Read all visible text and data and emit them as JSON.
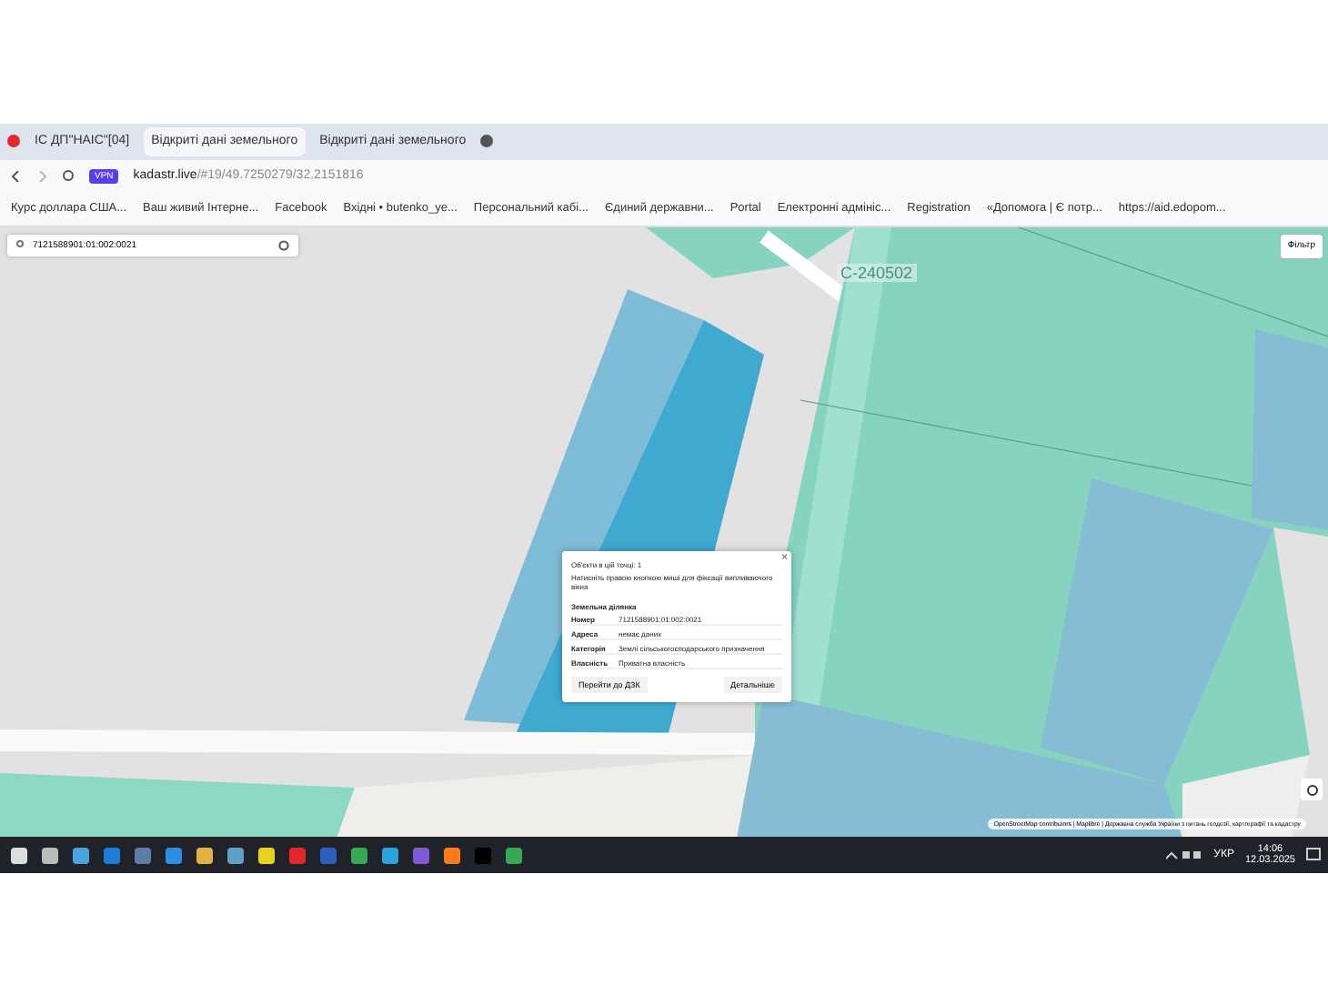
{
  "browser": {
    "tabs": [
      {
        "title": "ІС ДП\"НАІС\"[04]",
        "selected": false
      },
      {
        "title": "Відкриті дані земельного",
        "selected": true
      },
      {
        "title": "Відкриті дані земельного",
        "selected": false
      }
    ],
    "vpn": "VPN",
    "address": {
      "host": "kadastr.live",
      "path": "/#19/49.7250279/32.2151816"
    },
    "bookmarks": [
      "Курс доллара США...",
      "Ваш живий Інтерне...",
      "Facebook",
      "Вхідні • butenko_ye...",
      "Персональний кабі...",
      "Єдиний державни...",
      "Portal",
      "Електронні адмініс...",
      "Registration",
      "«Допомога | Є потр...",
      "https://aid.edopom..."
    ]
  },
  "map": {
    "search": {
      "value": "7121588901:01:002:0021"
    },
    "filter": "Фільтр",
    "label": "С-240502",
    "popup": {
      "close": "×",
      "title": "Об'єкти в цій точці: 1",
      "hint": "Натисніть правою кнопкою миші для фіксації випливаючого вікна",
      "section": "Земельна ділянка",
      "rows": [
        {
          "key": "Номер",
          "value": "7121588901:01:002:0021"
        },
        {
          "key": "Адреса",
          "value": "немає даних"
        },
        {
          "key": "Категорія",
          "value": "Землі сільськогосподарського призначення"
        },
        {
          "key": "Власність",
          "value": "Приватна власність"
        }
      ],
      "buttons": [
        "Перейти до ДЗК",
        "Детальніше"
      ]
    },
    "attribution": "OpenStreetMap contributors | Maplibre | Державна служба України з питань геодезії, картографії та кадастру"
  },
  "taskbar": {
    "language": "УКР",
    "time": "14:06",
    "date": "12.03.2025"
  }
}
